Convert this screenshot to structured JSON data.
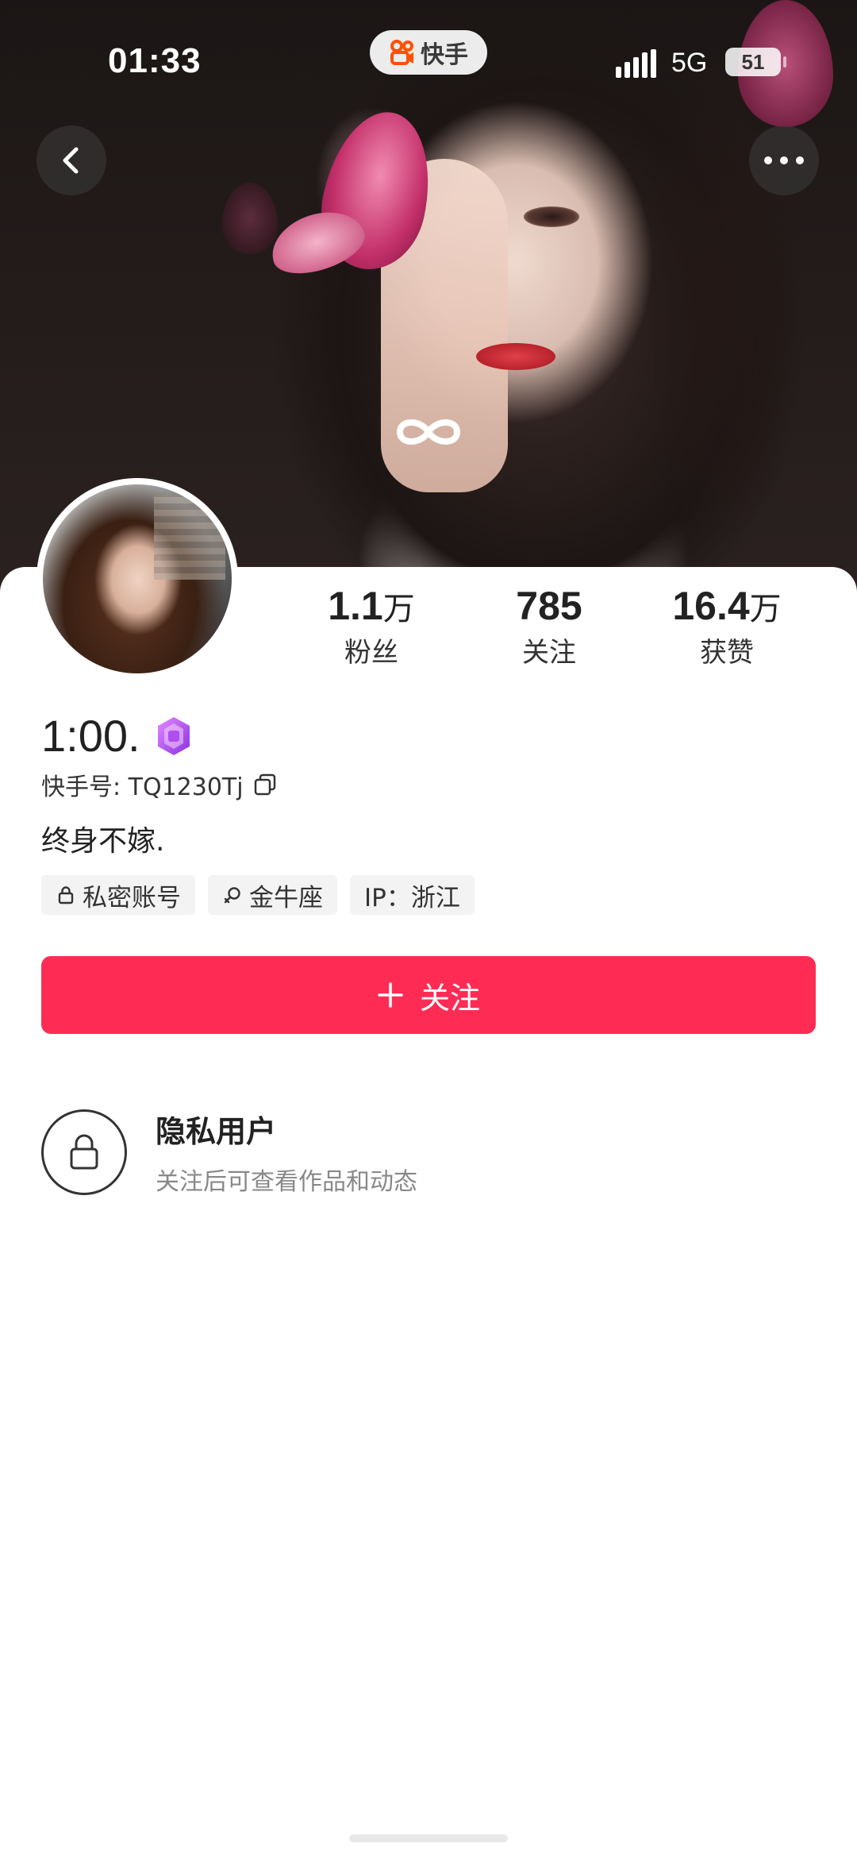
{
  "status_bar": {
    "time": "01:33",
    "app_name": "快手",
    "network": "5G",
    "battery": "51"
  },
  "profile": {
    "stats": [
      {
        "value": "1.1",
        "unit": "万",
        "label": "粉丝"
      },
      {
        "value": "785",
        "unit": "",
        "label": "关注"
      },
      {
        "value": "16.4",
        "unit": "万",
        "label": "获赞"
      }
    ],
    "username": "1:00.",
    "ks_id": "快手号: TQ1230Tj",
    "bio": "终身不嫁.",
    "tags": [
      "私密账号",
      "金牛座",
      "IP：浙江"
    ]
  },
  "actions": {
    "follow_label": "关注"
  },
  "private_notice": {
    "title": "隐私用户",
    "subtitle": "关注后可查看作品和动态"
  },
  "colors": {
    "accent": "#fe2c55",
    "brand": "#ff5000"
  },
  "icons": {
    "back": "chevron-left-icon",
    "more": "more-dots-icon",
    "copy": "copy-icon",
    "lock": "lock-icon",
    "zodiac": "zodiac-icon",
    "gem": "gem-badge-icon"
  }
}
